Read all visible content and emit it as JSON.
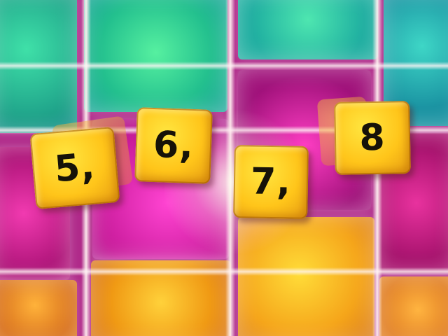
{
  "game": {
    "tiles": [
      {
        "label": "5,"
      },
      {
        "label": "6,"
      },
      {
        "label": "7,"
      },
      {
        "label": "8"
      }
    ]
  },
  "colors": {
    "tile": "#ffc51a",
    "tile_text": "#161208",
    "teal_blocks": "#23c08e",
    "magenta_blocks": "#c81a9a",
    "yellow_blocks": "#f5a51a"
  }
}
